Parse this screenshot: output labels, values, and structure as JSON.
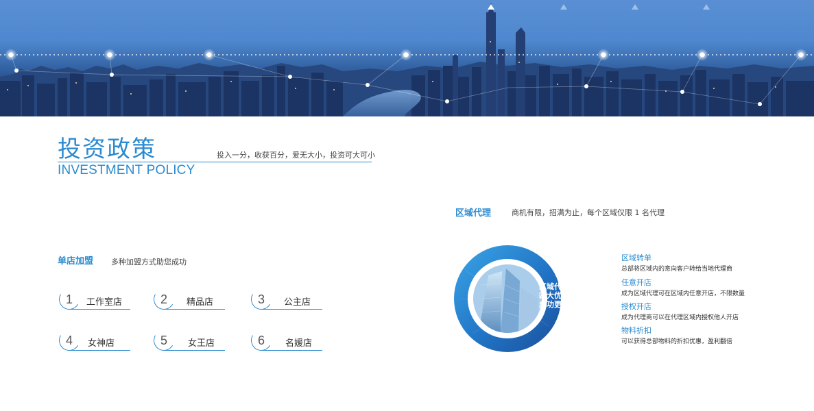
{
  "heading": {
    "title_cn": "投资政策",
    "title_en": "INVESTMENT POLICY",
    "slogan": "投入一分，收获百分，爱无大小，投资可大可小"
  },
  "single_store": {
    "title": "单店加盟",
    "subtitle": "多种加盟方式助您成功",
    "stores": [
      {
        "num": "1",
        "name": "工作室店"
      },
      {
        "num": "2",
        "name": "精品店"
      },
      {
        "num": "3",
        "name": "公主店"
      },
      {
        "num": "4",
        "name": "女神店"
      },
      {
        "num": "5",
        "name": "女王店"
      },
      {
        "num": "6",
        "name": "名媛店"
      }
    ]
  },
  "regional_agent": {
    "title": "区域代理",
    "subtitle": "商机有限，招满为止，每个区域仅限 1 名代理",
    "ring_lines": [
      "区域代理",
      "四大优势",
      "成功更迅捷"
    ],
    "advantages": [
      {
        "title": "区域转单",
        "desc": "总部将区域内的意向客户转给当地代理商"
      },
      {
        "title": "任意开店",
        "desc": "成为区域代理可在区域内任意开店，不限数量"
      },
      {
        "title": "授权开店",
        "desc": "成为代理商可以在代理区域内授权他人开店"
      },
      {
        "title": "物料折扣",
        "desc": "可以获得总部物料的折扣优惠，盈利翻倍"
      }
    ]
  },
  "colors": {
    "accent": "#2a8bd0",
    "ring_dark": "#1d5fb0",
    "ring_light": "#3aa6e6"
  }
}
